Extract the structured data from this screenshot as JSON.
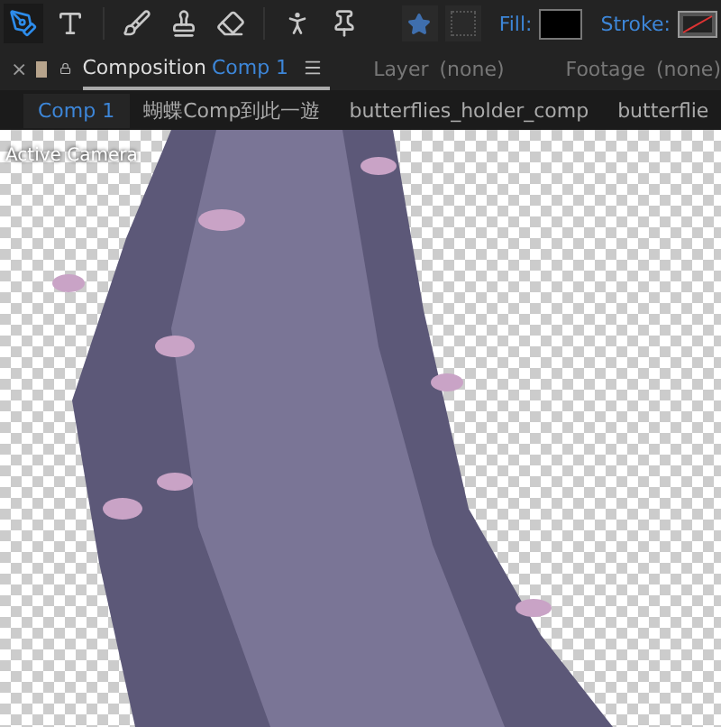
{
  "toolbar": {
    "tools": [
      {
        "selected": true
      },
      {
        "selected": false
      },
      {
        "selected": false
      },
      {
        "selected": false
      },
      {
        "selected": false
      },
      {
        "selected": false
      },
      {
        "selected": false
      }
    ],
    "fill_label": "Fill:",
    "stroke_label": "Stroke:"
  },
  "panel_tabs": {
    "close": "×",
    "composition": {
      "label": "Composition",
      "name": "Comp 1"
    },
    "layer": {
      "label": "Layer",
      "value": "(none)"
    },
    "footage": {
      "label": "Footage",
      "value": "(none)"
    }
  },
  "breadcrumbs": [
    {
      "label": "Comp 1",
      "selected": true
    },
    {
      "label": "蝴蝶Comp到此一遊",
      "selected": false
    },
    {
      "label": "butterflies_holder_comp",
      "selected": false
    },
    {
      "label": "butterflie",
      "selected": false
    }
  ],
  "viewer": {
    "camera_label": "Active Camera"
  }
}
